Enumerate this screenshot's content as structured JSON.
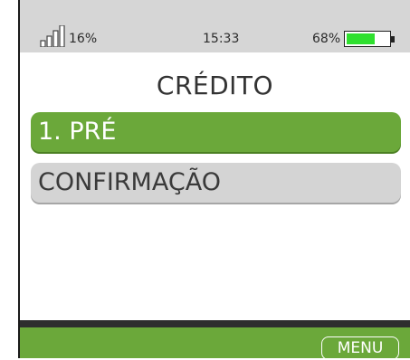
{
  "status": {
    "signal_percent": "16%",
    "time": "15:33",
    "battery_percent": "68%",
    "battery_level": 0.68,
    "battery_color": "#2fe02f",
    "signal_icon": "signal-bars-icon",
    "battery_icon": "battery-icon"
  },
  "screen": {
    "title": "CRÉDITO",
    "items": [
      {
        "label": "1. PRÉ",
        "selected": true
      },
      {
        "label": "CONFIRMAÇÃO",
        "selected": false
      }
    ]
  },
  "softkeys": {
    "menu_label": "MENU"
  },
  "colors": {
    "accent": "#6ba83a",
    "status_bg": "#d6d6d6",
    "item_bg": "#d4d4d4"
  }
}
